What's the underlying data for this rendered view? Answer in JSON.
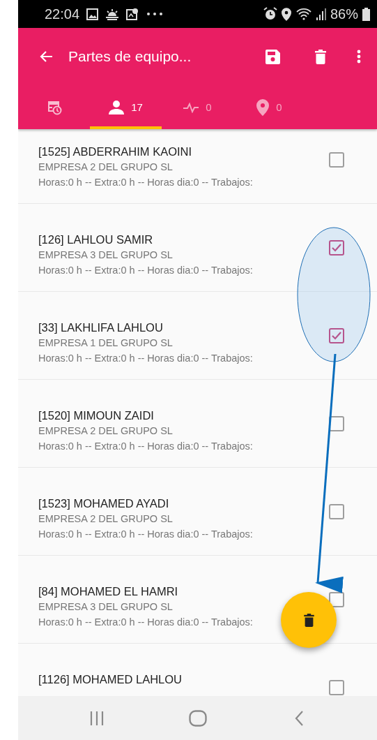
{
  "status_bar": {
    "time": "22:04",
    "battery": "86%"
  },
  "toolbar": {
    "title": "Partes de equipo..."
  },
  "tabs": [
    {
      "kind": "schedule",
      "selected": false
    },
    {
      "kind": "person",
      "count": "17",
      "selected": true
    },
    {
      "kind": "activity",
      "count": "0",
      "selected": false
    },
    {
      "kind": "place",
      "count": "0",
      "selected": false
    }
  ],
  "workers": [
    {
      "name": "[1525] ABDERRAHIM KAOINI",
      "company": "EMPRESA 2 DEL GRUPO SL",
      "summary": "Horas:0 h -- Extra:0 h -- Horas dia:0 -- Trabajos:",
      "checked": false
    },
    {
      "name": "[126] LAHLOU SAMIR",
      "company": "EMPRESA 3 DEL GRUPO SL",
      "summary": "Horas:0 h -- Extra:0 h -- Horas dia:0 -- Trabajos:",
      "checked": true
    },
    {
      "name": "[33] LAKHLIFA LAHLOU",
      "company": "EMPRESA 1 DEL GRUPO SL",
      "summary": "Horas:0 h -- Extra:0 h -- Horas dia:0 -- Trabajos:",
      "checked": true
    },
    {
      "name": "[1520] MIMOUN ZAIDI",
      "company": "EMPRESA 2 DEL GRUPO SL",
      "summary": "Horas:0 h -- Extra:0 h -- Horas dia:0 -- Trabajos:",
      "checked": false
    },
    {
      "name": "[1523] MOHAMED AYADI",
      "company": "EMPRESA 2 DEL GRUPO SL",
      "summary": "Horas:0 h -- Extra:0 h -- Horas dia:0 -- Trabajos:",
      "checked": false
    },
    {
      "name": "[84] MOHAMED EL HAMRI",
      "company": "EMPRESA 3 DEL GRUPO SL",
      "summary": "Horas:0 h -- Extra:0 h -- Horas dia:0 -- Trabajos:",
      "checked": false
    },
    {
      "name": "[1126] MOHAMED LAHLOU",
      "checked": false
    }
  ]
}
